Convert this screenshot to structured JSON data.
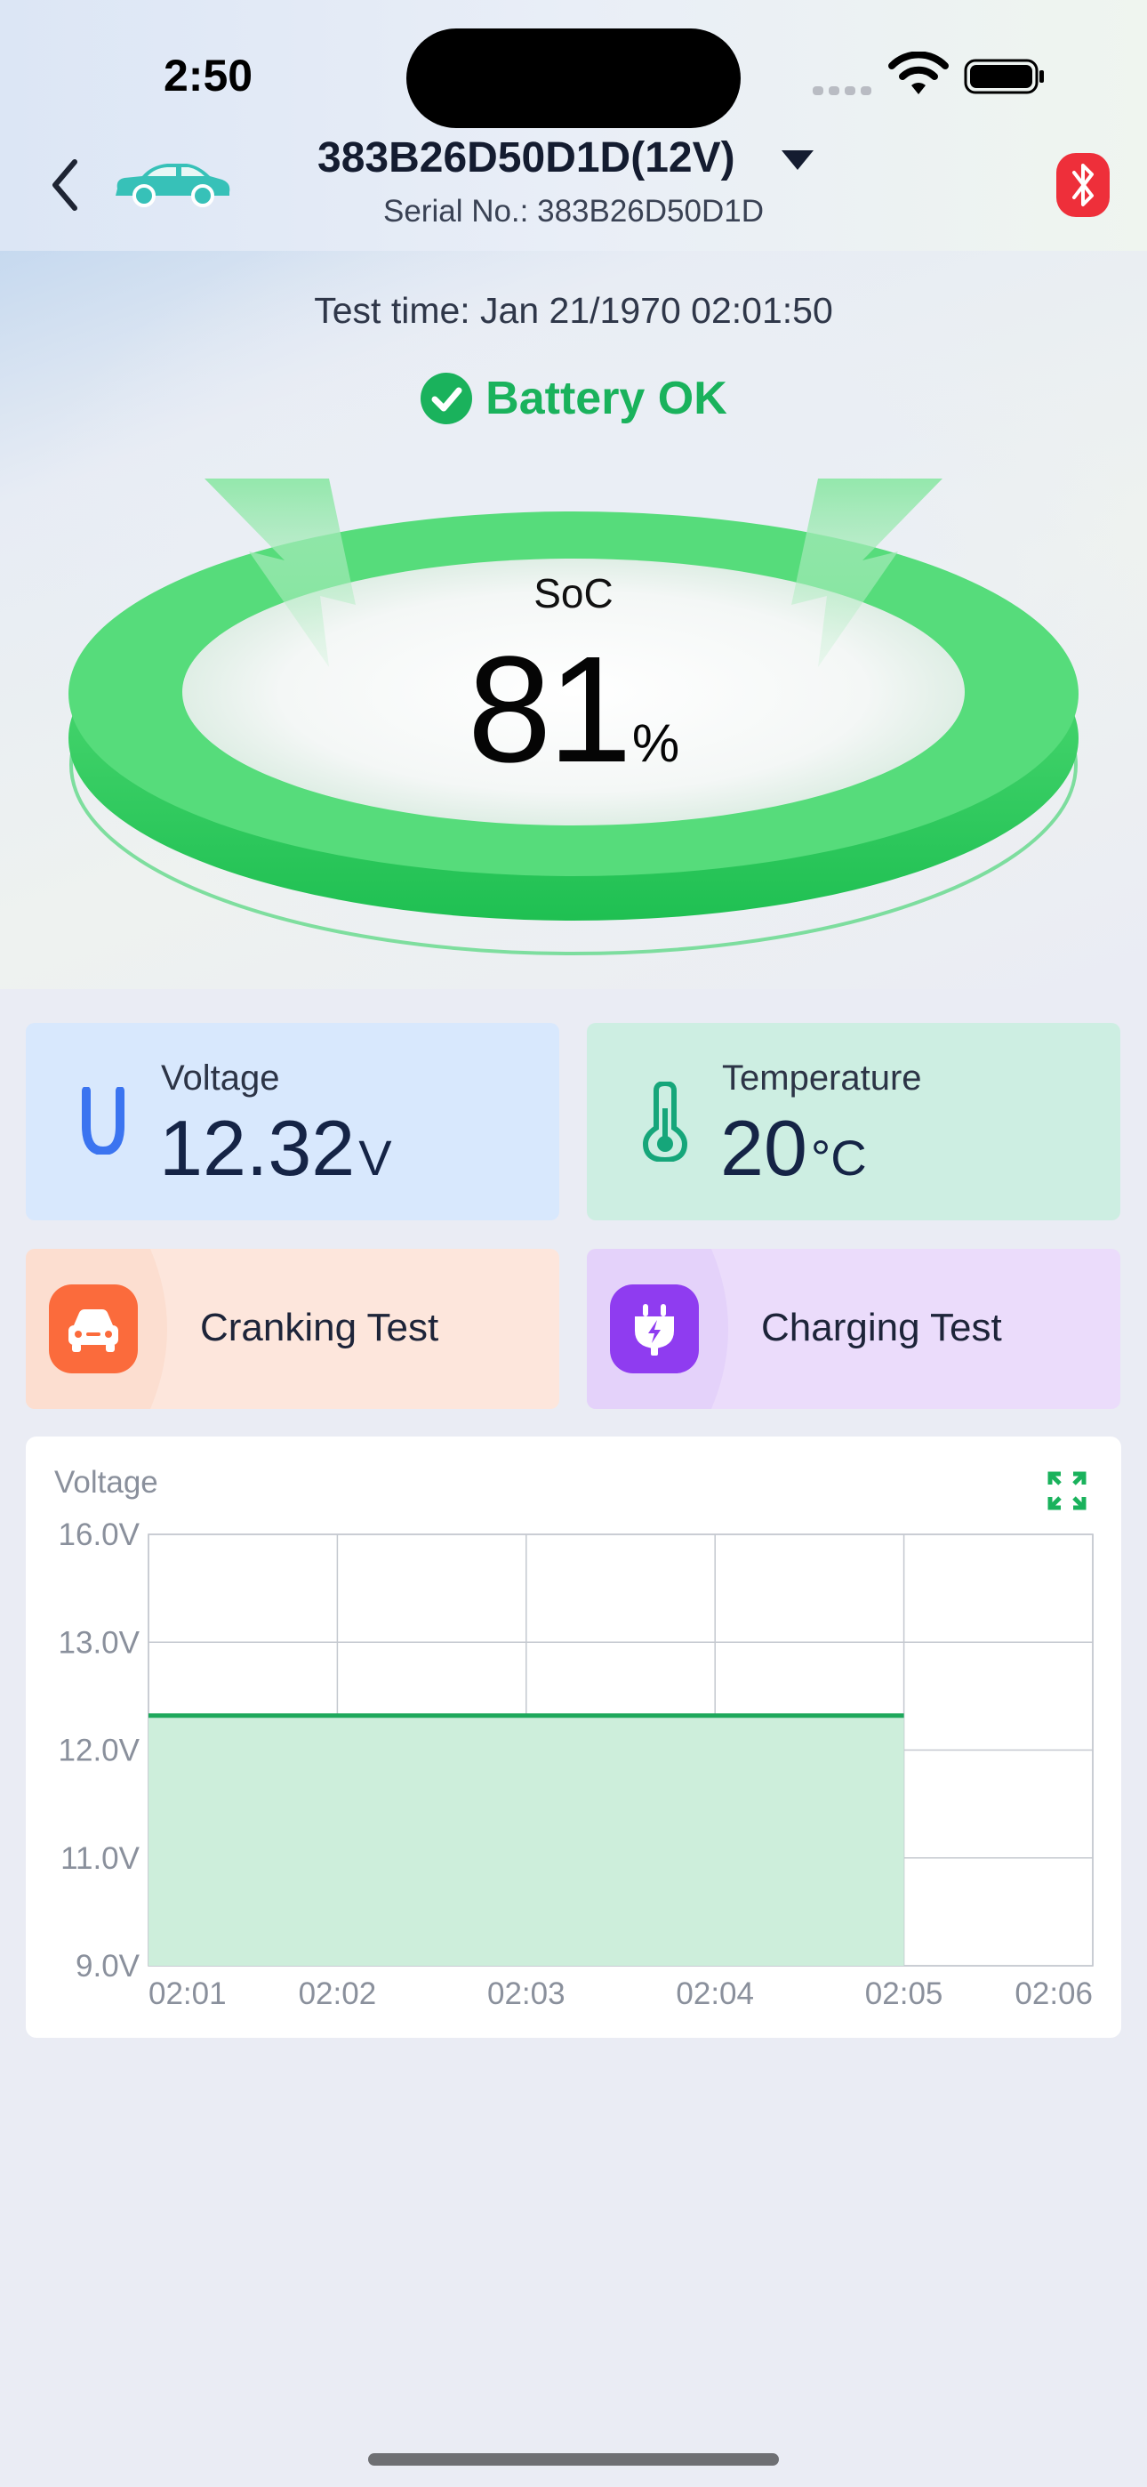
{
  "status_bar": {
    "time": "2:50"
  },
  "header": {
    "back_icon": "chevron-left-icon",
    "vehicle_icon": "car-icon",
    "device_name": "383B26D50D1D(12V)",
    "serial": "Serial No.: 383B26D50D1D",
    "bluetooth_icon": "bluetooth-icon",
    "bluetooth_color": "#ee2f3a"
  },
  "result": {
    "test_time": "Test time: Jan 21/1970 02:01:50",
    "status": "Battery OK",
    "status_color": "#1ab25c",
    "soc_label": "SoC",
    "soc_value": "81",
    "soc_unit": "%"
  },
  "metrics": {
    "voltage": {
      "label": "Voltage",
      "value": "12.32",
      "unit": "V",
      "icon": "voltage-icon"
    },
    "temperature": {
      "label": "Temperature",
      "value": "20",
      "unit": "°C",
      "icon": "thermometer-icon"
    }
  },
  "actions": {
    "cranking": {
      "label": "Cranking Test",
      "icon": "car-icon",
      "color": "#fb6b3c"
    },
    "charging": {
      "label": "Charging Test",
      "icon": "plug-charge-icon",
      "color": "#8f3cf0"
    }
  },
  "chart_data": {
    "type": "area",
    "title": "Voltage",
    "xlabel": "",
    "ylabel": "",
    "x_ticks": [
      "02:01",
      "02:02",
      "02:03",
      "02:04",
      "02:05",
      "02:06"
    ],
    "y_ticks": [
      "16.0V",
      "13.0V",
      "12.0V",
      "11.0V",
      "9.0V"
    ],
    "series": [
      {
        "values": [
          12.32,
          12.32,
          12.32,
          12.32,
          12.32,
          12.32,
          12.32,
          12.32,
          12.32,
          12.32,
          12.32,
          12.32,
          12.32,
          12.32,
          12.32,
          12.32,
          12.32,
          12.32,
          12.32,
          12.32,
          12.32,
          12.32,
          12.32,
          12.32,
          12.32,
          12.32,
          12.32,
          12.32,
          12.32,
          12.32,
          12.32,
          12.32,
          12.32,
          12.32,
          12.32,
          12.32,
          12.32,
          12.32,
          12.32,
          12.32,
          12.32,
          12.32,
          12.32,
          12.32,
          12.32,
          12.32,
          12.32,
          12.32,
          12.32,
          12.32,
          12.32,
          12.32,
          12.32,
          12.32,
          12.32,
          12.32,
          12.32,
          12.32,
          12.32,
          12.32,
          12.32,
          12.32,
          12.32,
          12.32,
          12.32,
          12.32,
          12.32,
          12.32,
          12.32,
          12.32,
          12.32,
          12.32,
          12.32,
          12.32,
          12.32,
          12.32,
          12.32,
          12.32,
          12.32,
          12.32,
          12.32,
          12.32,
          12.32,
          12.32,
          12.32,
          12.32,
          12.32,
          12.32,
          12.32,
          12.32,
          12.32,
          12.32,
          12.32,
          12.32,
          12.32,
          12.32,
          12.32,
          12.32,
          12.32,
          12.32,
          12.32,
          12.32,
          12.32,
          12.32,
          12.32,
          12.32,
          12.32,
          12.32,
          12.32,
          12.32,
          12.32,
          12.32,
          12.32,
          12.32,
          12.32,
          12.32,
          12.32,
          12.32,
          12.32,
          12.32,
          12.32,
          12.32,
          12.32,
          12.32,
          12.32,
          12.32,
          12.32,
          12.32,
          12.32,
          12.32,
          12.32,
          12.32,
          12.32,
          12.32,
          12.32,
          12.32,
          12.32,
          12.32,
          12.32,
          12.32,
          12.32,
          12.32,
          12.32,
          12.32,
          12.32,
          12.32,
          12.32,
          12.32,
          12.32,
          12.32,
          12.32,
          12.32,
          12.32,
          12.32,
          12.32,
          12.32,
          12.32,
          12.32,
          12.32,
          12.32,
          12.32,
          12.32,
          12.32,
          12.32,
          12.32,
          12.32,
          12.32,
          12.32,
          12.32,
          12.32,
          12.32,
          12.32,
          12.32,
          12.32,
          12.32,
          12.32,
          12.32,
          12.32,
          12.32,
          12.32,
          12.32,
          12.32,
          12.32,
          12.32,
          12.32,
          12.32,
          12.32,
          12.32,
          12.32,
          12.32,
          12.32,
          12.32,
          12.32,
          12.32,
          12.32,
          12.32,
          12.32,
          12.32,
          12.32,
          12.32,
          12.32,
          12.32,
          12.32,
          12.32,
          12.32,
          12.32,
          12.32,
          12.32,
          12.32,
          12.32,
          12.32,
          12.32,
          12.32,
          12.32,
          12.32,
          12.32,
          12.32,
          12.32,
          12.32,
          12.32,
          12.32,
          12.32,
          12.32,
          12.32,
          12.32,
          12.32,
          12.32,
          12.32,
          12.32,
          12.32,
          12.32,
          12.32,
          12.32,
          12.32,
          12.32,
          12.32,
          12.32,
          12.32,
          12.32,
          12.32,
          12.32,
          12.32,
          12.32
        ]
      }
    ],
    "x_start": "02:01",
    "x_end": "02:05",
    "line_color": "#1ea85c",
    "fill_color": "#cdeedb",
    "grid": true,
    "expand_icon": "expand-icon"
  }
}
